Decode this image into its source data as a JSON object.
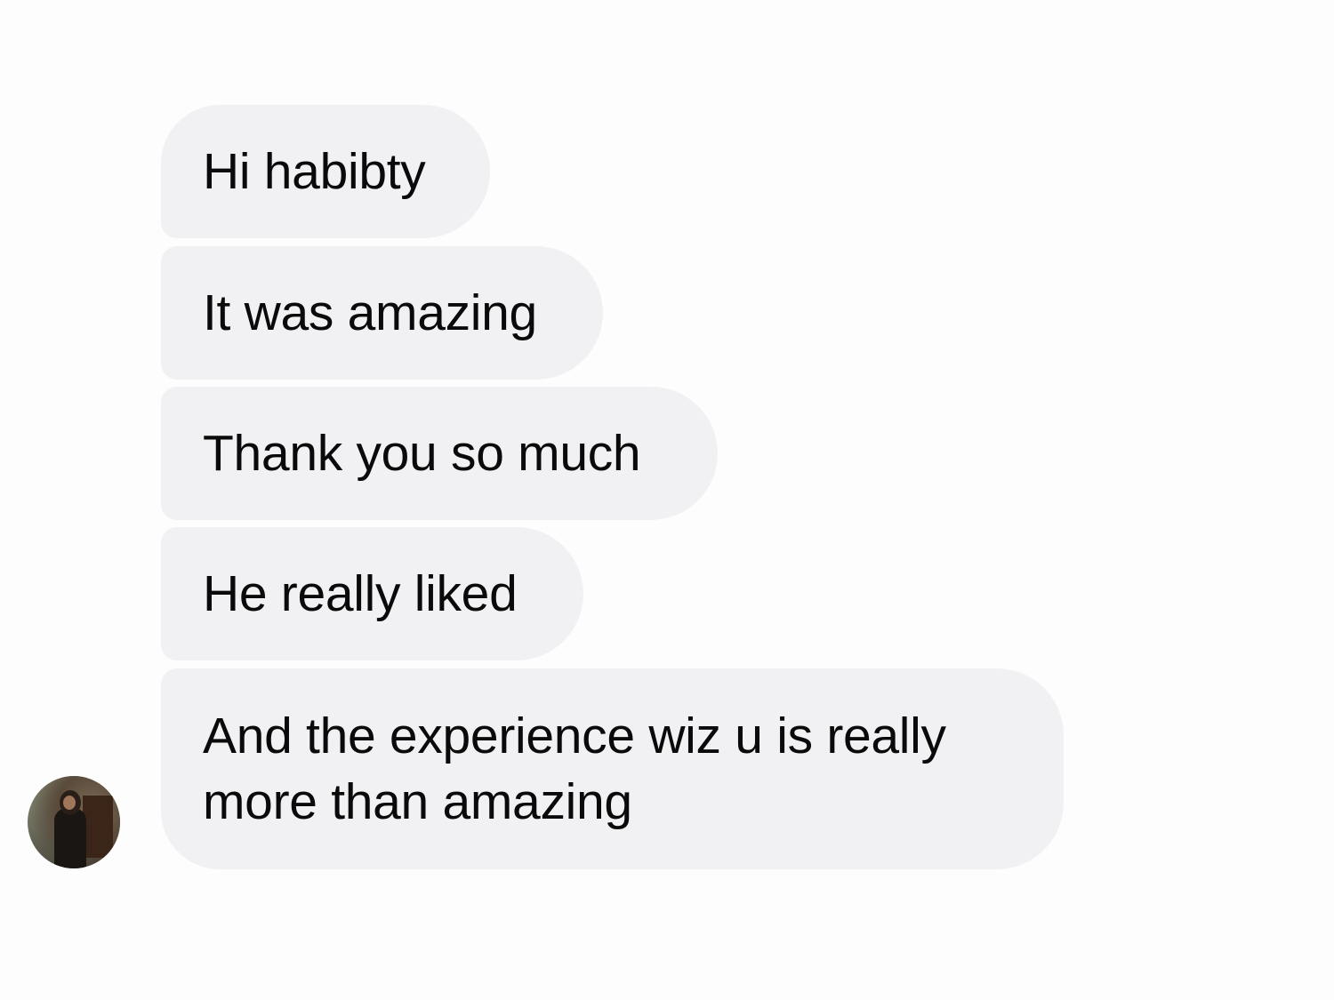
{
  "conversation": {
    "messages": [
      {
        "text": "Hi habibty"
      },
      {
        "text": "It was amazing"
      },
      {
        "text": "Thank you so much"
      },
      {
        "text": "He really liked"
      },
      {
        "text": "And the experience wiz u is really more than amazing"
      }
    ],
    "avatar_icon": "contact-photo",
    "bubble_color": "#f1f1f4",
    "background_color": "#fdfdfe"
  }
}
